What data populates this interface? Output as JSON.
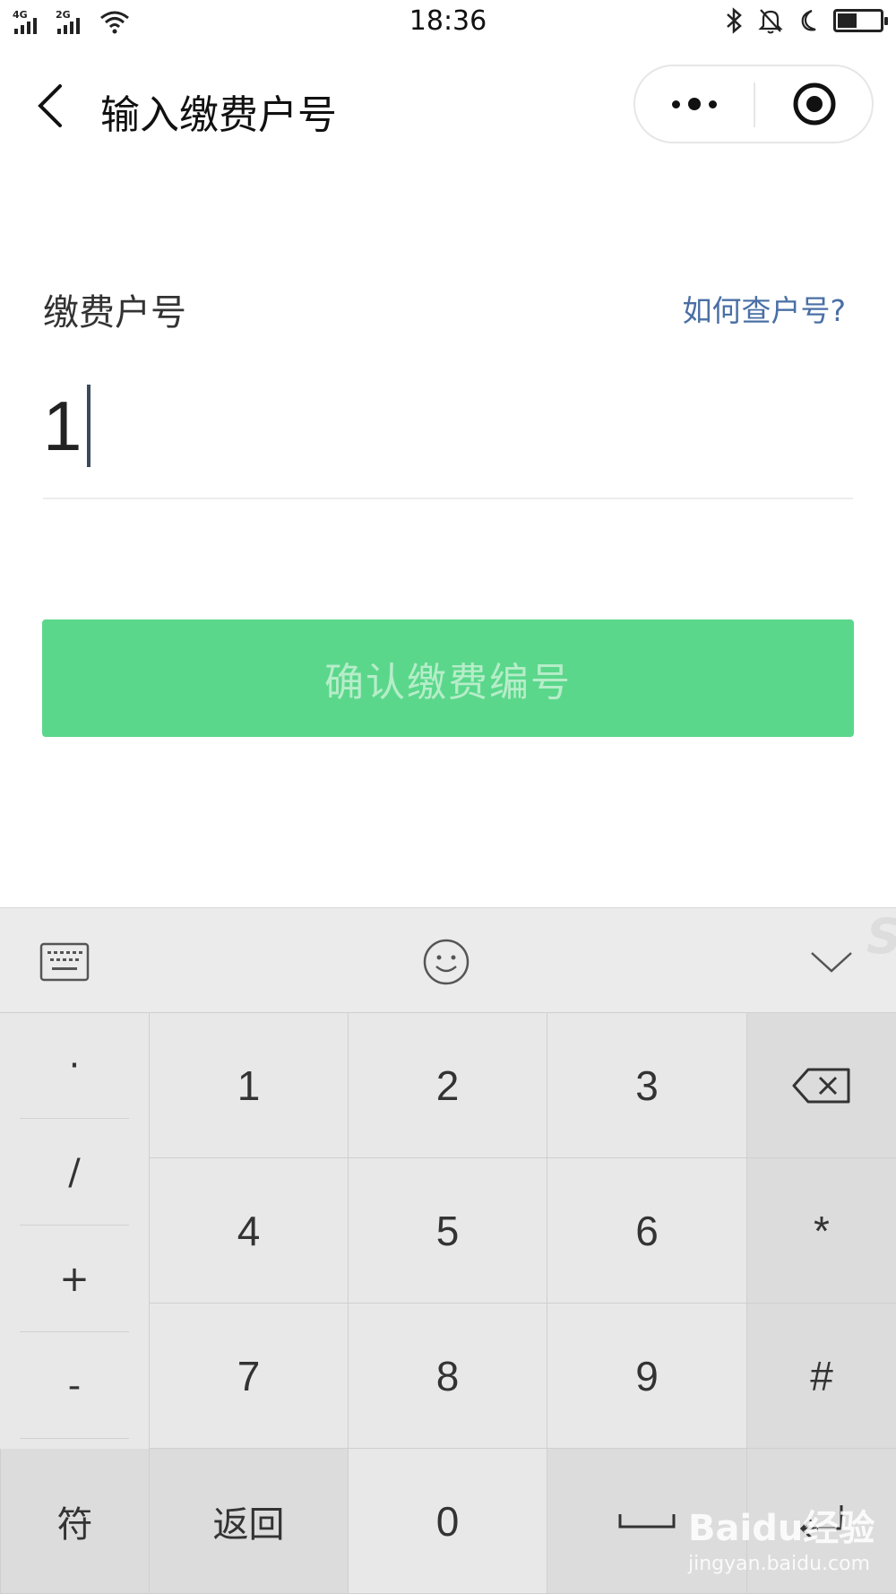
{
  "status_bar": {
    "time": "18:36",
    "signal_1_label": "4G",
    "signal_2_label": "2G",
    "battery_level": 0.45,
    "icons": [
      "signal-icon",
      "signal-icon",
      "wifi-icon",
      "bluetooth-icon",
      "mute-bell-icon",
      "do-not-disturb-moon-icon",
      "battery-icon"
    ]
  },
  "navbar": {
    "title": "输入缴费户号",
    "back_icon": "chevron-left-icon",
    "more_icon": "more-dots-icon",
    "close_icon": "target-close-icon"
  },
  "form": {
    "label": "缴费户号",
    "help_link": "如何查户号?",
    "input_value": "1",
    "confirm_button": "确认缴费编号",
    "confirm_color": "#5bd78b"
  },
  "keyboard": {
    "toolbar_icons": [
      "keyboard-icon",
      "emoji-icon",
      "collapse-chevron-icon"
    ],
    "symbol_keys": [
      "·",
      "/",
      "+",
      "-"
    ],
    "rows": [
      [
        "1",
        "2",
        "3"
      ],
      [
        "4",
        "5",
        "6"
      ],
      [
        "7",
        "8",
        "9"
      ]
    ],
    "right_keys": [
      "*",
      "#"
    ],
    "bottom": {
      "symbols": "符",
      "back": "返回",
      "zero": "0"
    },
    "backspace_icon": "backspace-icon",
    "space_icon": "space-icon",
    "enter_icon": "enter-icon"
  },
  "watermark": {
    "brand": "Baidu经验",
    "url": "jingyan.baidu.com"
  }
}
